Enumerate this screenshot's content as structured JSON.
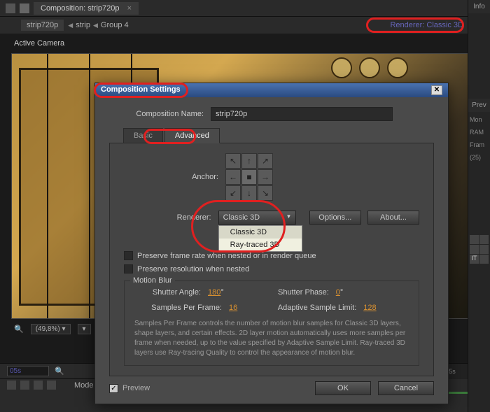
{
  "top_bar": {
    "comp_tab": "Composition: strip720p"
  },
  "breadcrumb": {
    "crumb1": "strip720p",
    "crumb2": "strip",
    "crumb3": "Group 4"
  },
  "renderer_info": {
    "label": "Renderer:",
    "value": "Classic 3D"
  },
  "active_camera": "Active Camera",
  "status": {
    "zoom": "(49,8%)"
  },
  "side": {
    "info": "Info",
    "prev": "Prev",
    "mon": "Mon",
    "ram": "RAM",
    "fram": "Fram",
    "fram_val": "(25)"
  },
  "timeline": {
    "time": "05s",
    "mode": "Mode"
  },
  "dialog": {
    "title": "Composition Settings",
    "comp_name_label": "Composition Name:",
    "comp_name": "strip720p",
    "tab_basic": "Basic",
    "tab_advanced": "Advanced",
    "anchor_label": "Anchor:",
    "renderer_label": "Renderer:",
    "renderer_value": "Classic 3D",
    "renderer_options": {
      "opt1": "Classic 3D",
      "opt2": "Ray-traced 3D"
    },
    "options_btn": "Options...",
    "about_btn": "About...",
    "preserve_frame": "Preserve frame rate when nested or in render queue",
    "preserve_res": "Preserve resolution when nested",
    "motion_blur": {
      "legend": "Motion Blur",
      "shutter_angle_label": "Shutter Angle:",
      "shutter_angle": "180",
      "deg": "°",
      "shutter_phase_label": "Shutter Phase:",
      "shutter_phase": "0",
      "samples_label": "Samples Per Frame:",
      "samples": "16",
      "adaptive_label": "Adaptive Sample Limit:",
      "adaptive": "128",
      "help": "Samples Per Frame controls the number of motion blur samples for Classic 3D layers, shape layers, and certain effects. 2D layer motion automatically uses more samples per frame when needed, up to the value specified by Adaptive Sample Limit. Ray-traced 3D layers use Ray-tracing Quality to control the appearance of motion blur."
    },
    "preview": "Preview",
    "ok": "OK",
    "cancel": "Cancel"
  }
}
